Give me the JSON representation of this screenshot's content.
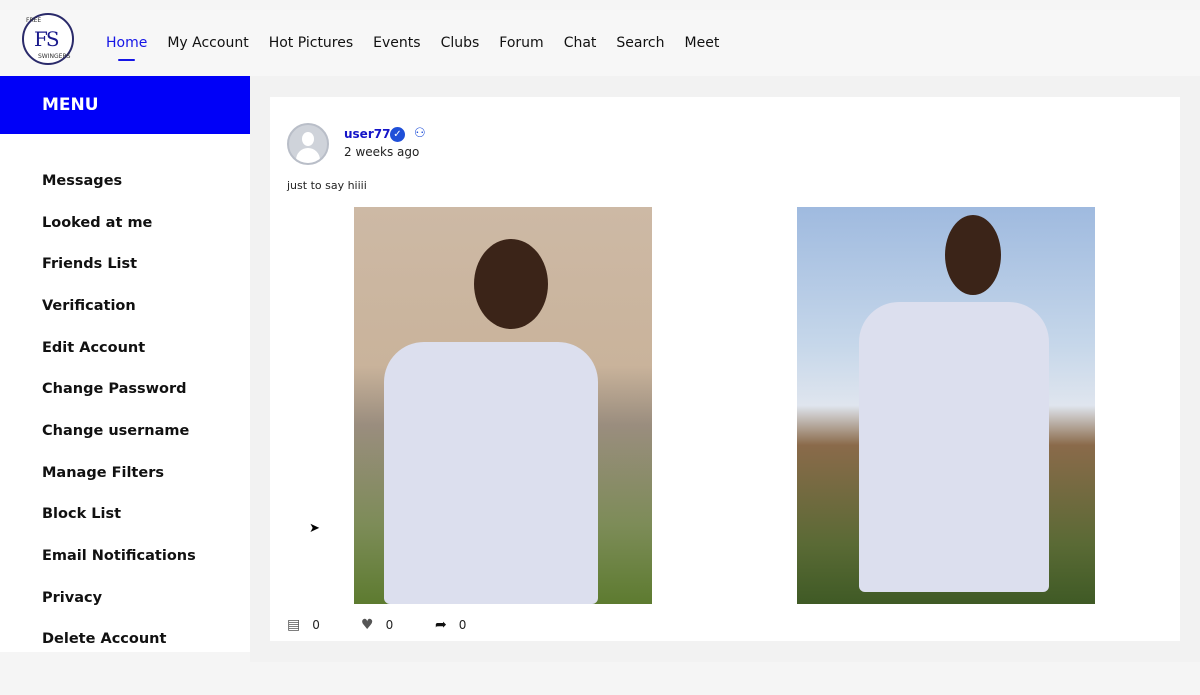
{
  "brand": {
    "logo_letters": "FS",
    "logo_top": "FREE",
    "logo_bottom": "SWINGERS"
  },
  "nav": {
    "items": [
      {
        "label": "Home",
        "active": true
      },
      {
        "label": "My Account"
      },
      {
        "label": "Hot Pictures"
      },
      {
        "label": "Events"
      },
      {
        "label": "Clubs"
      },
      {
        "label": "Forum"
      },
      {
        "label": "Chat"
      },
      {
        "label": "Search"
      },
      {
        "label": "Meet"
      }
    ]
  },
  "sidebar": {
    "title": "MENU",
    "items": [
      {
        "label": "Messages"
      },
      {
        "label": "Looked at me"
      },
      {
        "label": "Friends List"
      },
      {
        "label": "Verification"
      },
      {
        "label": "Edit Account"
      },
      {
        "label": "Change Password"
      },
      {
        "label": "Change username"
      },
      {
        "label": "Manage Filters"
      },
      {
        "label": "Block List"
      },
      {
        "label": "Email Notifications"
      },
      {
        "label": "Privacy"
      },
      {
        "label": "Delete Account"
      }
    ]
  },
  "post": {
    "username": "user77",
    "time": "2 weeks ago",
    "text": "just to say hiiii",
    "comments": "0",
    "likes": "0",
    "shares": "0"
  },
  "colors": {
    "accent": "#1515e6",
    "menu_bg": "#0000f8"
  }
}
